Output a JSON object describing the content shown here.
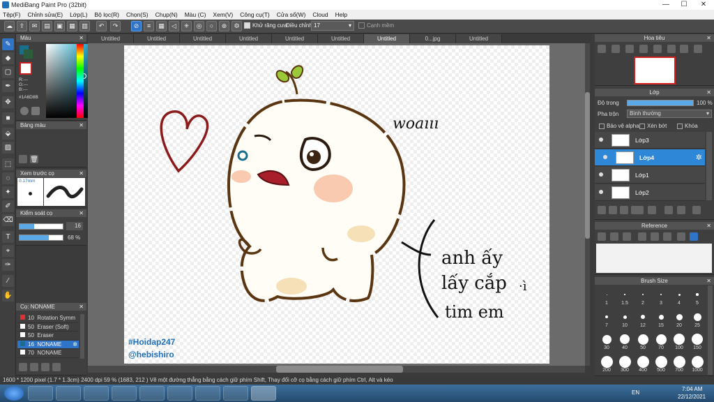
{
  "window": {
    "title": "MediBang Paint Pro (32bit)",
    "min": "—",
    "max": "☐",
    "close": "✕"
  },
  "menu": [
    "Tệp(F)",
    "Chỉnh sửa(E)",
    "Lớp(L)",
    "Bộ lọc(R)",
    "Chọn(S)",
    "Chụp(N)",
    "Màu (C)",
    "Xem(V)",
    "Công cụ(T)",
    "Cửa sổ(W)",
    "Cloud",
    "Help"
  ],
  "toolbar": {
    "antialias_label": "Khử răng cưa",
    "adjust_label": "Điều chỉnh",
    "adjust_value": "17",
    "snap_label": "Cạnh mềm"
  },
  "tabs": [
    "Untitled",
    "Untitled",
    "Untitled",
    "Untitled",
    "Untitled",
    "Untitled",
    "Untitled",
    "0...jpg",
    "Untitled"
  ],
  "color_panel": {
    "title": "Màu",
    "r": "R:---",
    "g": "G:---",
    "b": "B:---",
    "hex": "#1A6D8B"
  },
  "palette_panel": {
    "title": "Bảng màu"
  },
  "brush_preview": {
    "title": "Xem trước cọ",
    "size": "0.17mm"
  },
  "brush_control": {
    "title": "Kiểm soát cọ",
    "size_value": "16",
    "opacity_value": "68 %"
  },
  "brush_list": {
    "title": "Cọ: NONAME",
    "items": [
      {
        "size": "10",
        "name": "Rotation Symm",
        "color": "#e03030"
      },
      {
        "size": "50",
        "name": "Eraser (Soft)",
        "color": "#ffffff"
      },
      {
        "size": "50",
        "name": "Eraser",
        "color": "#ffffff"
      },
      {
        "size": "16",
        "name": "NONAME",
        "color": "#1A6D8B",
        "selected": true
      },
      {
        "size": "70",
        "name": "NONAME",
        "color": "#ffffff"
      }
    ]
  },
  "navigator": {
    "title": "Hoa tiêu"
  },
  "layers_panel": {
    "title": "Lớp",
    "opacity_label": "Độ trong",
    "opacity_value": "100 %",
    "blend_label": "Pha trộn",
    "blend_value": "Bình thường",
    "protect_alpha": "Bảo vệ alpha",
    "clipping": "Xén bớt",
    "lock": "Khóa",
    "layers": [
      {
        "name": "Lớp3"
      },
      {
        "name": "Lớp4",
        "selected": true
      },
      {
        "name": "Lớp1"
      },
      {
        "name": "Lớp2"
      }
    ]
  },
  "reference_panel": {
    "title": "Reference"
  },
  "brush_size_panel": {
    "title": "Brush Size",
    "sizes": [
      "1",
      "1.5",
      "2",
      "3",
      "4",
      "5",
      "7",
      "10",
      "12",
      "15",
      "20",
      "25",
      "30",
      "40",
      "50",
      "70",
      "100",
      "150",
      "200",
      "300",
      "400",
      "500",
      "700",
      "1000"
    ]
  },
  "artwork": {
    "text1": "woaııı",
    "text2_line1": "anh ấy",
    "text2_line2": "lấy cắp",
    "text2_line3": "tim em",
    "text2_mark": "·ì",
    "watermark1": "#Hoidap247",
    "watermark2": "@hebishiro"
  },
  "status": "1600 * 1200 pixel  (1.7 * 1.3cm)  2400 dpi  59 %  (1683, 212 )  Vẽ một đường thẳng bằng cách giữ phím Shift, Thay đổi cỡ cọ bằng cách giữ phím Ctrl, Alt và kéo",
  "taskbar": {
    "lang": "EN",
    "time": "7:04 AM",
    "date": "22/12/2021"
  },
  "colors": {
    "accent": "#2f74c7",
    "outline": "#5a3511",
    "heart": "#8b1a1a"
  }
}
